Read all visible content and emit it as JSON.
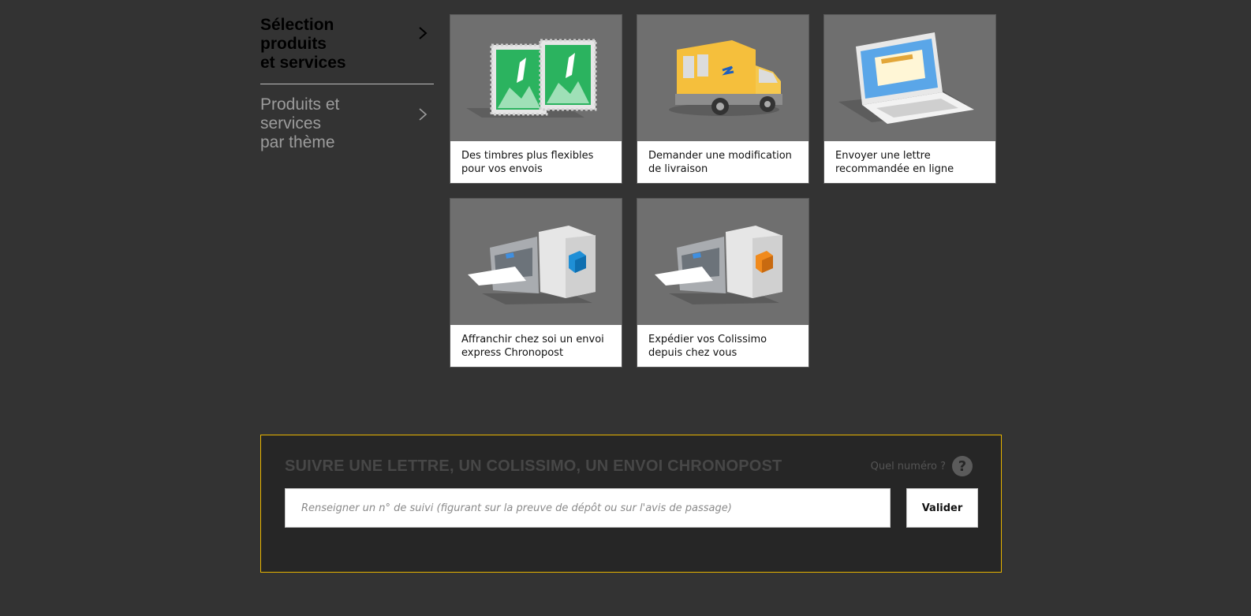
{
  "sidebar": {
    "items": [
      {
        "label": "Sélection produits\net services",
        "active": true
      },
      {
        "label": "Produits et services\npar thème",
        "active": false
      }
    ]
  },
  "tiles": [
    {
      "icon": "stamps-icon",
      "caption": "Des timbres plus flexibles pour vos envois"
    },
    {
      "icon": "delivery-van-icon",
      "caption": "Demander une modification de livraison"
    },
    {
      "icon": "laptop-letter-icon",
      "caption": "Envoyer une lettre recommandée en ligne"
    },
    {
      "icon": "printer-parcel-blue-icon",
      "caption": "Affranchir chez soi un envoi express Chronopost"
    },
    {
      "icon": "printer-parcel-orange-icon",
      "caption": "Expédier vos Colissimo depuis chez vous"
    }
  ],
  "tracking": {
    "title": "SUIVRE UNE LETTRE, UN COLISSIMO, UN ENVOI CHRONOPOST",
    "help_label": "Quel numéro ?",
    "help_icon": "?",
    "placeholder": "Renseigner un n° de suivi (figurant sur la preuve de dépôt ou sur l'avis de passage)",
    "button_label": "Valider"
  },
  "colors": {
    "background": "#333333",
    "tile_image_bg": "#6f6f6f",
    "accent_border": "#e8b400",
    "stamp_green": "#2bb35f",
    "van_yellow": "#f5bf3c",
    "chronopost_blue": "#1f8fd6",
    "colissimo_orange": "#f08a1c"
  }
}
